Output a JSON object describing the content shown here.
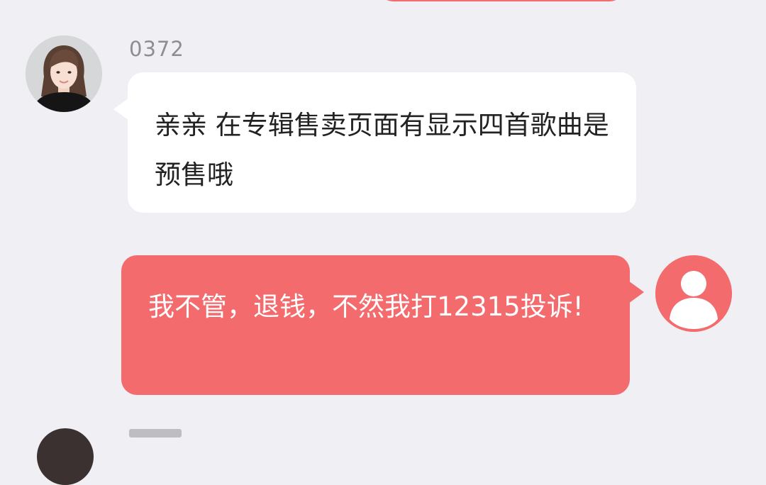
{
  "conversation": {
    "messages": [
      {
        "direction": "incoming",
        "sender": "0372",
        "text": "亲亲 在专辑售卖页面有显示四首歌曲是预售哦",
        "avatar_icon": "agent-photo-avatar",
        "bubble_color": "#ffffff",
        "text_color": "#222222"
      },
      {
        "direction": "outgoing",
        "text": "我不管，退钱，不然我打12315投诉!",
        "avatar_icon": "default-user-icon",
        "bubble_color": "#f46b6e",
        "text_color": "#ffffff"
      }
    ]
  },
  "theme": {
    "background": "#efeff4",
    "accent": "#f46b6e",
    "name_color": "#8d8e92"
  }
}
